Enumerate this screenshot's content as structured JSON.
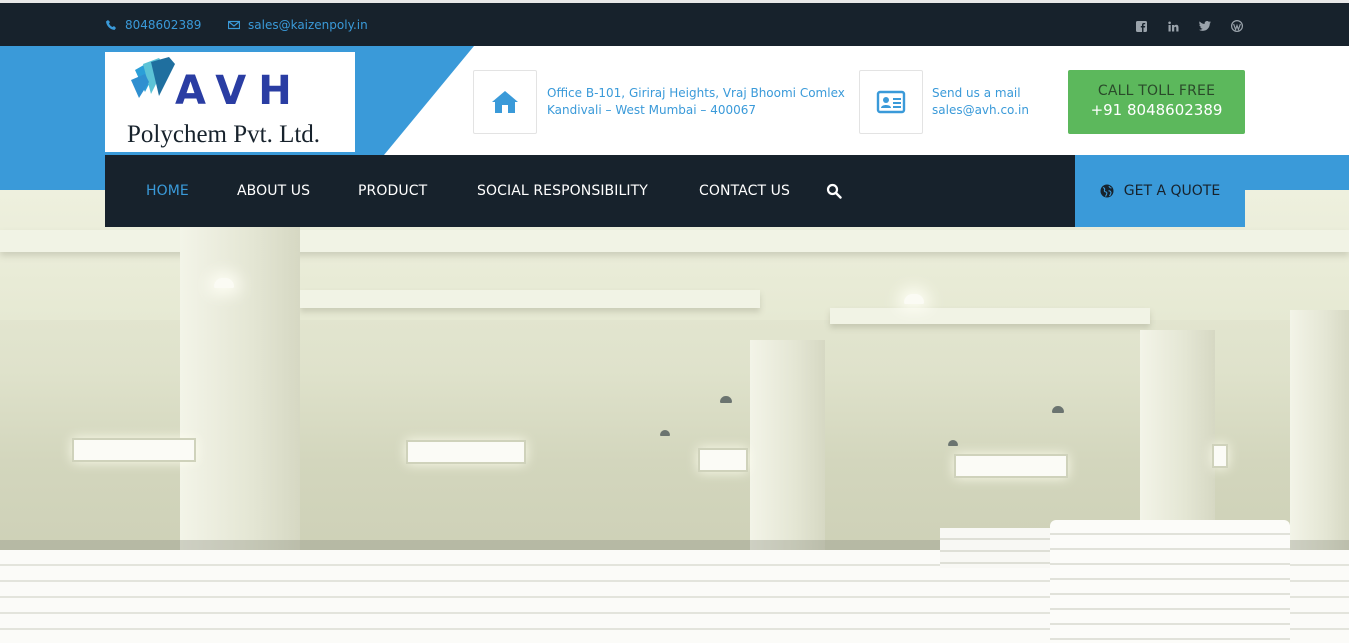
{
  "topbar": {
    "phone": "8048602389",
    "email": "sales@kaizenpoly.in",
    "socials": [
      "facebook-icon",
      "linkedin-icon",
      "twitter-icon",
      "wordpress-icon"
    ]
  },
  "logo": {
    "mark": "AVH",
    "company": "Polychem Pvt. Ltd."
  },
  "address": {
    "line1": "Office B-101, Giriraj Heights, Vraj Bhoomi Comlex",
    "line2": "Kandivali – West Mumbai – 400067"
  },
  "mail": {
    "line1": "Send us a mail",
    "line2": "sales@avh.co.in"
  },
  "call": {
    "title": "CALL TOLL FREE",
    "number": "+91 8048602389"
  },
  "nav": {
    "items": [
      {
        "label": "HOME",
        "active": true
      },
      {
        "label": "ABOUT US",
        "active": false
      },
      {
        "label": "PRODUCT",
        "active": false
      },
      {
        "label": "SOCIAL RESPONSIBILITY",
        "active": false
      },
      {
        "label": "CONTACT US",
        "active": false
      }
    ],
    "quote_label": "GET A QUOTE"
  },
  "colors": {
    "accent": "#3a9ad9",
    "dark": "#17222c",
    "call_green": "#5cb85c"
  }
}
